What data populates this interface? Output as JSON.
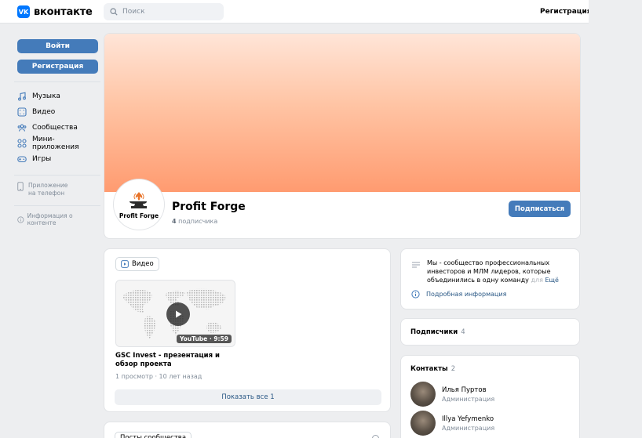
{
  "header": {
    "logo_mark": "VK",
    "logo_text": "вконтакте",
    "search_placeholder": "Поиск",
    "register_label": "Регистрация"
  },
  "sidebar": {
    "login_label": "Войти",
    "register_label": "Регистрация",
    "items": [
      {
        "label": "Музыка",
        "icon": "music-icon"
      },
      {
        "label": "Видео",
        "icon": "video-icon"
      },
      {
        "label": "Сообщества",
        "icon": "communities-icon"
      },
      {
        "label": "Мини-приложения",
        "icon": "mini-apps-icon"
      },
      {
        "label": "Игры",
        "icon": "games-icon"
      }
    ],
    "app_line1": "Приложение",
    "app_line2": "на телефон",
    "info_label": "Информация о контенте"
  },
  "profile": {
    "avatar_text": "Profit Forge",
    "name": "Profit Forge",
    "subs_count": "4",
    "subs_label": "подписчика",
    "subscribe_label": "Подписаться"
  },
  "video_section": {
    "tag_label": "Видео",
    "video": {
      "duration": "YouTube · 9:59",
      "title": "GSC Invest - презентация и обзор проекта",
      "meta": "1 просмотр · 10 лет назад"
    },
    "show_all_label": "Показать все 1"
  },
  "posts_section": {
    "tag_label": "Посты сообщества"
  },
  "about": {
    "text": "Мы - сообщество профессиональных инвесторов и МЛМ лидеров, которые объединились в одну команду ",
    "fade_text": "для",
    "more_label": "Ещё",
    "detail_label": "Подробная информация"
  },
  "subscribers": {
    "title": "Подписчики",
    "count": "4"
  },
  "contacts": {
    "title": "Контакты",
    "count": "2",
    "items": [
      {
        "name": "Илья Пуртов",
        "role": "Администрация"
      },
      {
        "name": "Illya Yefymenko",
        "role": "Администрация"
      }
    ]
  },
  "colors": {
    "accent": "#447bba",
    "link": "#2a5885",
    "muted": "#818c99",
    "cover_top": "#ffe5d8",
    "cover_bottom": "#ff9b70"
  }
}
